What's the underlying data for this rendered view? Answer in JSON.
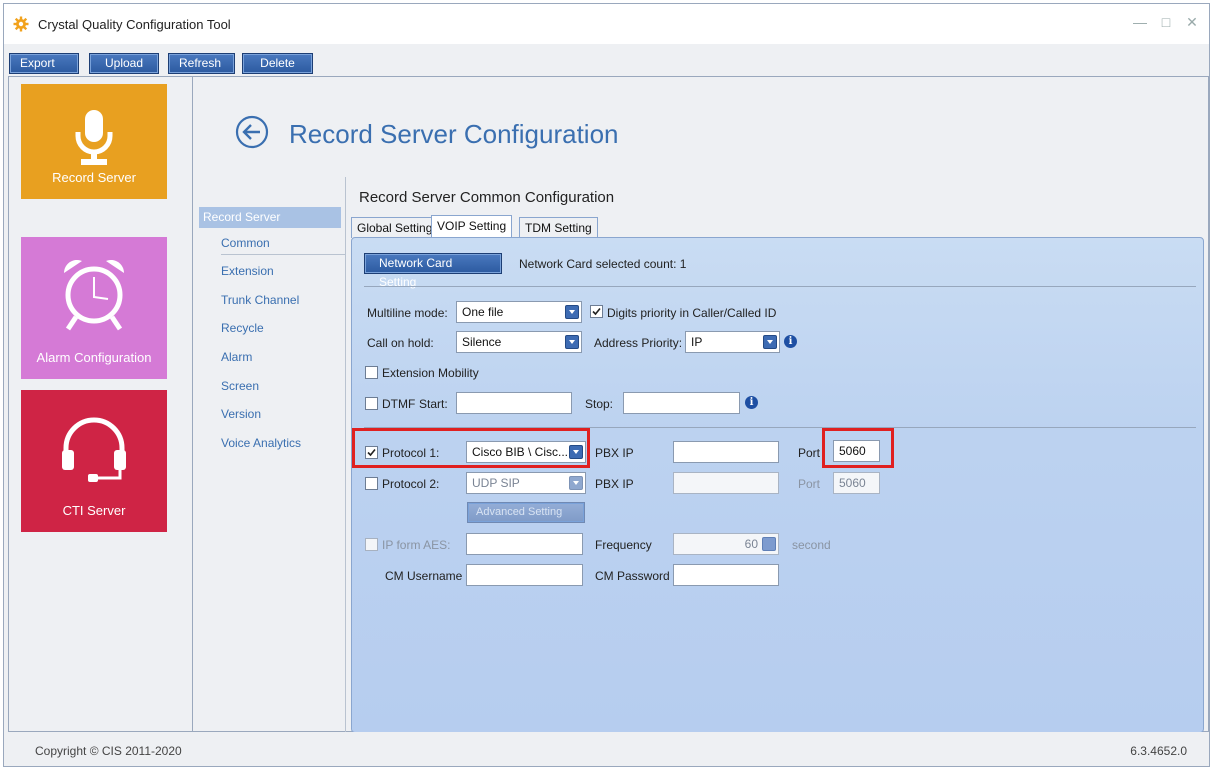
{
  "app": {
    "title": "Crystal Quality Configuration Tool"
  },
  "toolbar": {
    "export": "Export",
    "upload": "Upload",
    "refresh": "Refresh",
    "delete": "Delete"
  },
  "tiles": [
    {
      "label": "Record Server",
      "color": "#e8a020"
    },
    {
      "label": "Alarm Configuration",
      "color": "#d57ad6"
    },
    {
      "label": "CTI Server",
      "color": "#cf2445"
    }
  ],
  "page": {
    "title": "Record Server Configuration"
  },
  "subnav": {
    "header": "Record Server",
    "items": [
      "Common",
      "Extension",
      "Trunk Channel",
      "Recycle",
      "Alarm",
      "Screen",
      "Version",
      "Voice Analytics"
    ]
  },
  "section": {
    "title": "Record Server Common Configuration"
  },
  "tabs": [
    "Global Setting",
    "VOIP Setting",
    "TDM Setting"
  ],
  "voip": {
    "network_card_button": "Network Card Setting",
    "network_card_status": "Network Card selected count: 1",
    "multiline_label": "Multiline mode:",
    "multiline_value": "One file",
    "digits_priority_label": "Digits priority in Caller/Called ID",
    "call_on_hold_label": "Call on hold:",
    "call_on_hold_value": "Silence",
    "address_priority_label": "Address Priority:",
    "address_priority_value": "IP",
    "extension_mobility_label": "Extension Mobility",
    "dtmf_label": "DTMF",
    "start_label": "Start:",
    "stop_label": "Stop:",
    "protocol1_label": "Protocol 1:",
    "protocol1_value": "Cisco BIB \\ Cisc...",
    "protocol2_label": "Protocol 2:",
    "protocol2_value": "UDP SIP",
    "pbx_ip_label": "PBX IP",
    "port_label": "Port",
    "port1_value": "5060",
    "port2_value": "5060",
    "advanced_button": "Advanced Setting",
    "ip_form_aes_label": "IP form AES:",
    "frequency_label": "Frequency",
    "frequency_value": "60",
    "second_label": "second",
    "cm_username_label": "CM Username",
    "cm_password_label": "CM Password"
  },
  "status": {
    "copyright": "Copyright © CIS 2011-2020",
    "version": "6.3.4652.0"
  }
}
